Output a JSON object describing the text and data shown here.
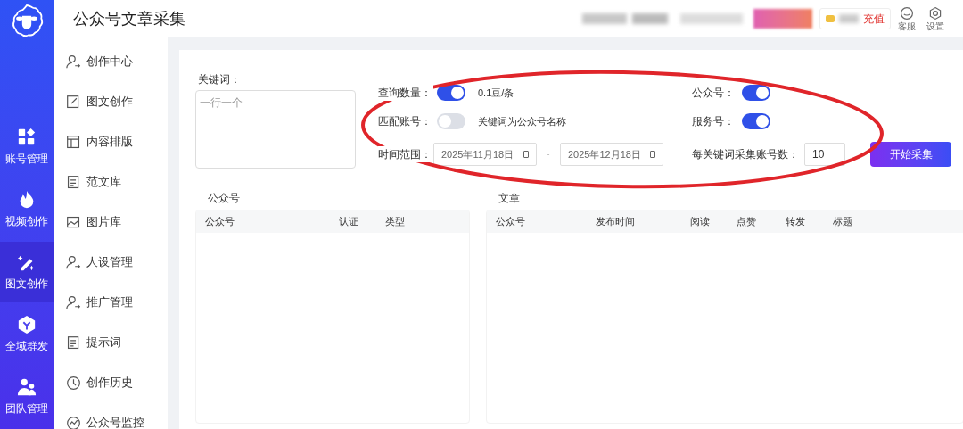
{
  "app": {
    "title": "公众号文章采集"
  },
  "sidebar": {
    "items": [
      {
        "label": "账号管理",
        "selected": false
      },
      {
        "label": "视频创作",
        "selected": false
      },
      {
        "label": "图文创作",
        "selected": true
      },
      {
        "label": "全域群发",
        "selected": false
      },
      {
        "label": "团队管理",
        "selected": false
      }
    ]
  },
  "subnav": {
    "items": [
      {
        "label": "创作中心"
      },
      {
        "label": "图文创作"
      },
      {
        "label": "内容排版"
      },
      {
        "label": "范文库"
      },
      {
        "label": "图片库"
      },
      {
        "label": "人设管理"
      },
      {
        "label": "推广管理"
      },
      {
        "label": "提示词"
      },
      {
        "label": "创作历史"
      },
      {
        "label": "公众号监控"
      }
    ]
  },
  "header": {
    "recharge": "充值",
    "tools": [
      {
        "label": "客服"
      },
      {
        "label": "设置"
      }
    ]
  },
  "form": {
    "keyword_label": "关键词：",
    "keyword_placeholder": "一行一个",
    "toggles": [
      {
        "label": "查询数量：",
        "on": true,
        "note": "0.1豆/条"
      },
      {
        "label": "匹配账号：",
        "on": false,
        "note": "关键词为公众号名称"
      },
      {
        "label": "公众号：",
        "on": true
      },
      {
        "label": "服务号：",
        "on": true
      }
    ],
    "date_label": "时间范围：",
    "date_from": "2025年11月18日",
    "date_sep": "-",
    "date_to": "2025年12月18日",
    "count_label": "每关键词采集账号数：",
    "count_value": "10",
    "submit": "开始采集"
  },
  "accounts": {
    "title": "公众号",
    "columns": [
      "公众号",
      "认证",
      "类型"
    ]
  },
  "articles": {
    "title": "文章",
    "columns": [
      "公众号",
      "发布时间",
      "阅读",
      "点赞",
      "转发",
      "标题"
    ]
  }
}
